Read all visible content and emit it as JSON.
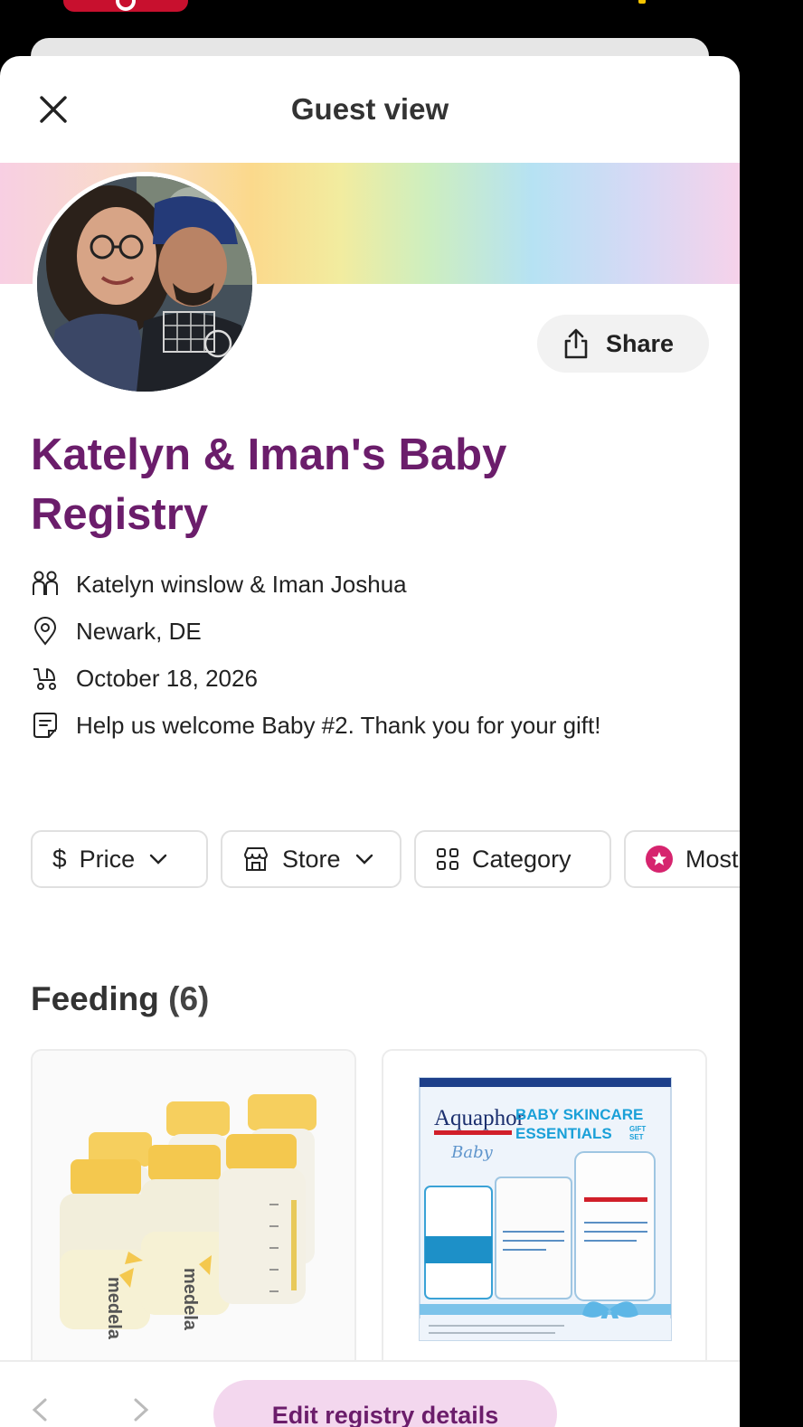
{
  "header": {
    "title": "Guest view"
  },
  "profile": {
    "share_label": "Share",
    "registry_title": "Katelyn & Iman's Baby Registry"
  },
  "info": {
    "names": "Katelyn winslow & Iman Joshua",
    "location": "Newark, DE",
    "date": "October 18, 2026",
    "message": "Help us welcome Baby #2. Thank you for your gift!"
  },
  "filters": {
    "price": "Price",
    "store": "Store",
    "category": "Category",
    "most": "Most"
  },
  "section": {
    "title": "Feeding",
    "count": "(6)"
  },
  "products": [
    {
      "brand_text": "medela"
    },
    {
      "brand_text": "Aquaphor",
      "headline": "BABY SKINCARE ESSENTIALS",
      "tag": "GIFT SET",
      "script": "Baby"
    }
  ],
  "bottom_bar": {
    "edit_label": "Edit registry details"
  },
  "colors": {
    "title_purple": "#6b1d6b",
    "edit_pill": "#f3d7ee",
    "accent_pink": "#d6246e"
  }
}
